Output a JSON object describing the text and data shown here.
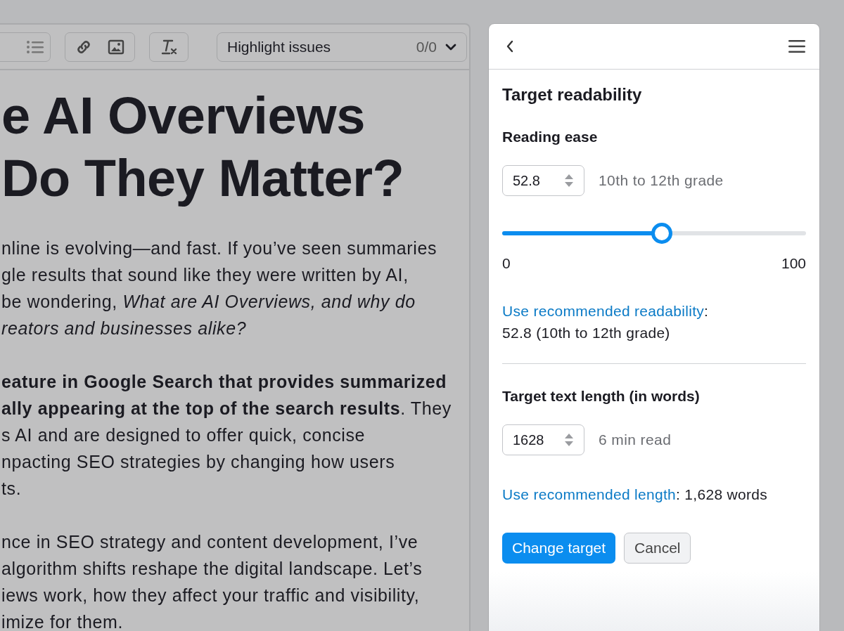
{
  "editor": {
    "toolbar": {
      "highlight": {
        "label": "Highlight issues",
        "count": "0/0"
      }
    },
    "heading": [
      "e AI Overviews",
      "Do They Matter?"
    ],
    "paragraphs": [
      [
        {
          "text": "nline is evolving—and fast. If you’ve seen summaries",
          "kind": "plain"
        },
        {
          "text": "gle results that sound like they were written by AI,",
          "kind": "plain"
        },
        {
          "text": "be wondering, *What are AI Overviews, and why do*",
          "kind": "plain"
        },
        {
          "text": "reators and businesses alike?",
          "kind": "italic"
        }
      ],
      [
        {
          "text": "eature in Google Search that provides summarized",
          "kind": "bold"
        },
        {
          "text": "**ally appearing at the top of the search results**. They",
          "kind": "plain"
        },
        {
          "text": "s AI and are designed to offer quick, concise",
          "kind": "plain"
        },
        {
          "text": "npacting SEO strategies by changing how users",
          "kind": "plain"
        },
        {
          "text": "ts.",
          "kind": "plain"
        }
      ],
      [
        {
          "text": "nce in SEO strategy and content development, I’ve",
          "kind": "plain"
        },
        {
          "text": "algorithm shifts reshape the digital landscape. Let’s",
          "kind": "plain"
        },
        {
          "text": "iews work, how they affect your traffic and visibility,",
          "kind": "plain"
        },
        {
          "text": "imize for them.",
          "kind": "plain"
        }
      ]
    ]
  },
  "panel": {
    "title": "Target readability",
    "reading_ease": {
      "heading": "Reading ease",
      "value": "52.8",
      "grade": "10th to 12th grade",
      "level": 0.525,
      "min": "0",
      "max": "100",
      "link": "Use recommended readability",
      "link_suffix": ":",
      "recommendation": "52.8 (10th to 12th grade)"
    },
    "text_length": {
      "heading": "Target text length (in words)",
      "value": "1628",
      "read_time": "6 min read",
      "link": "Use recommended length",
      "link_suffix": ": 1,628 words"
    },
    "buttons": [
      {
        "label": "Change target",
        "kind": "primary"
      },
      {
        "label": "Cancel",
        "kind": "secondary"
      }
    ]
  }
}
